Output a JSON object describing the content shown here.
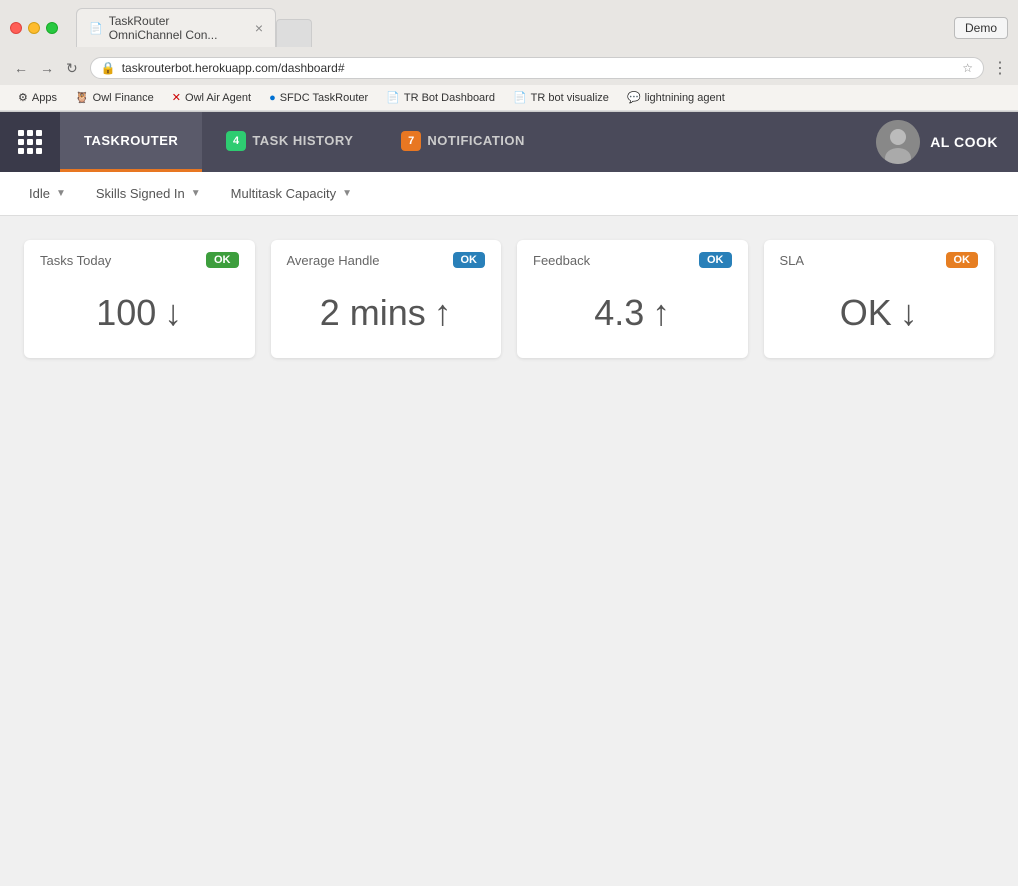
{
  "browser": {
    "tab_title": "TaskRouter OmniChannel Con...",
    "tab_icon": "📄",
    "url": "taskrouterbot.herokuapp.com/dashboard#",
    "demo_button": "Demo"
  },
  "bookmarks": [
    {
      "id": "apps",
      "icon": "⚙",
      "label": "Apps"
    },
    {
      "id": "owl-finance",
      "icon": "🦉",
      "label": "Owl Finance"
    },
    {
      "id": "owl-air-agent",
      "icon": "🔴",
      "label": "Owl Air Agent"
    },
    {
      "id": "sfdc-taskrouter",
      "icon": "🔵",
      "label": "SFDC TaskRouter"
    },
    {
      "id": "tr-bot-dashboard",
      "icon": "📄",
      "label": "TR Bot Dashboard"
    },
    {
      "id": "tr-bot-visualize",
      "icon": "📄",
      "label": "TR bot visualize"
    },
    {
      "id": "lightning-agent",
      "icon": "💬",
      "label": "lightnining agent"
    }
  ],
  "header": {
    "app_name": "TASKROUTER",
    "tabs": [
      {
        "id": "taskrouter",
        "label": "TASKROUTER",
        "active": true,
        "badge": null
      },
      {
        "id": "task-history",
        "label": "TASK HISTORY",
        "active": false,
        "badge": {
          "value": "4",
          "color": "badge-green"
        }
      },
      {
        "id": "notification",
        "label": "NOTIFICATION",
        "active": false,
        "badge": {
          "value": "7",
          "color": "badge-orange"
        }
      }
    ],
    "user": {
      "name": "AL COOK",
      "avatar_text": "👤"
    }
  },
  "toolbar": {
    "items": [
      {
        "id": "idle",
        "label": "Idle",
        "has_dropdown": true
      },
      {
        "id": "skills-signed-in",
        "label": "Skills Signed In",
        "has_dropdown": true
      },
      {
        "id": "multitask-capacity",
        "label": "Multitask Capacity",
        "has_dropdown": true
      }
    ]
  },
  "metrics": [
    {
      "id": "tasks-today",
      "title": "Tasks Today",
      "badge_label": "OK",
      "badge_class": "badge-ok-green",
      "value": "100",
      "arrow": "↓",
      "arrow_dir": "down"
    },
    {
      "id": "average-handle",
      "title": "Average Handle",
      "badge_label": "OK",
      "badge_class": "badge-ok-teal",
      "value": "2 mins",
      "arrow": "↑",
      "arrow_dir": "up"
    },
    {
      "id": "feedback",
      "title": "Feedback",
      "badge_label": "OK",
      "badge_class": "badge-ok-teal",
      "value": "4.3",
      "arrow": "↑",
      "arrow_dir": "up"
    },
    {
      "id": "sla",
      "title": "SLA",
      "badge_label": "OK",
      "badge_class": "badge-ok-orange",
      "value": "OK",
      "arrow": "↓",
      "arrow_dir": "down"
    }
  ]
}
